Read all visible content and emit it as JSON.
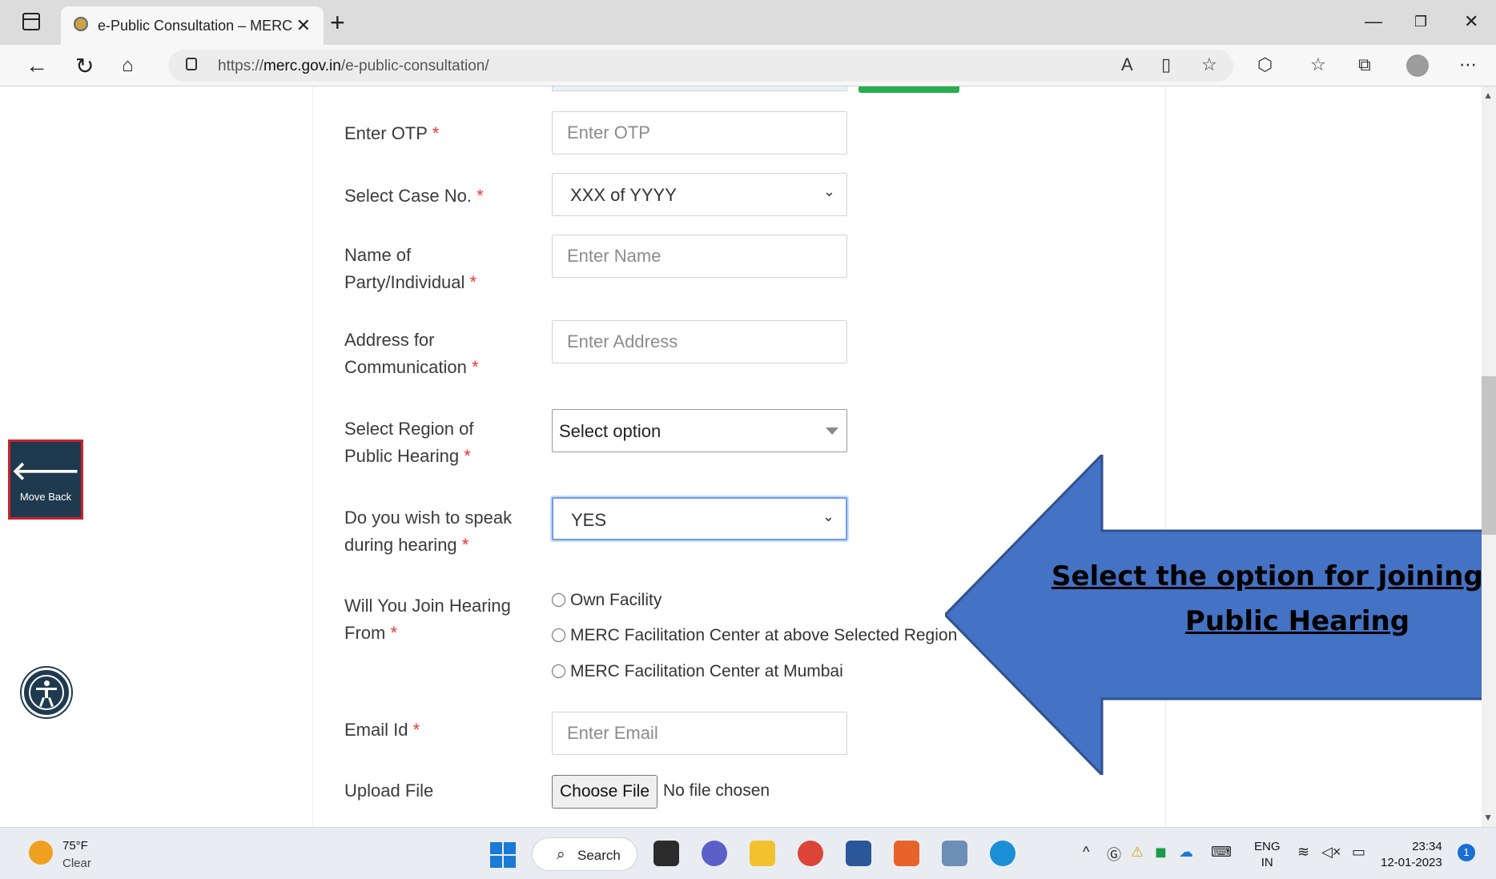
{
  "browser": {
    "tab_title": "e-Public Consultation – MERC",
    "url_prefix": "https://",
    "url_host": "merc.gov.in",
    "url_path": "/e-public-consultation/"
  },
  "form": {
    "otp_label": "Enter OTP",
    "otp_placeholder": "Enter OTP",
    "case_label": "Select Case No.",
    "case_value": "XXX of YYYY",
    "name_label_1": "Name of",
    "name_label_2": "Party/Individual",
    "name_placeholder": "Enter Name",
    "address_label_1": "Address for",
    "address_label_2": "Communication",
    "address_placeholder": "Enter Address",
    "region_label_1": "Select Region of",
    "region_label_2": "Public Hearing",
    "region_value": "Select option",
    "speak_label_1": "Do you wish to speak",
    "speak_label_2": "during hearing",
    "speak_value": "YES",
    "join_label_1": "Will You Join Hearing",
    "join_label_2": "From",
    "join_options": [
      "Own Facility",
      "MERC Facilitation Center at above Selected Region",
      "MERC Facilitation Center at Mumbai"
    ],
    "email_label": "Email Id",
    "email_placeholder": "Enter Email",
    "upload_label": "Upload File",
    "file_button": "Choose File",
    "file_status": "No file chosen",
    "required_mark": "*"
  },
  "side": {
    "move_back": "Move Back"
  },
  "callout": {
    "line1": "Select the option for joining the",
    "line2": "Public Hearing",
    "color": "#4472c4"
  },
  "taskbar": {
    "temp": "75°F",
    "weather": "Clear",
    "search": "Search",
    "lang1": "ENG",
    "lang2": "IN",
    "time": "23:34",
    "date": "12-01-2023",
    "notifications": "1"
  }
}
